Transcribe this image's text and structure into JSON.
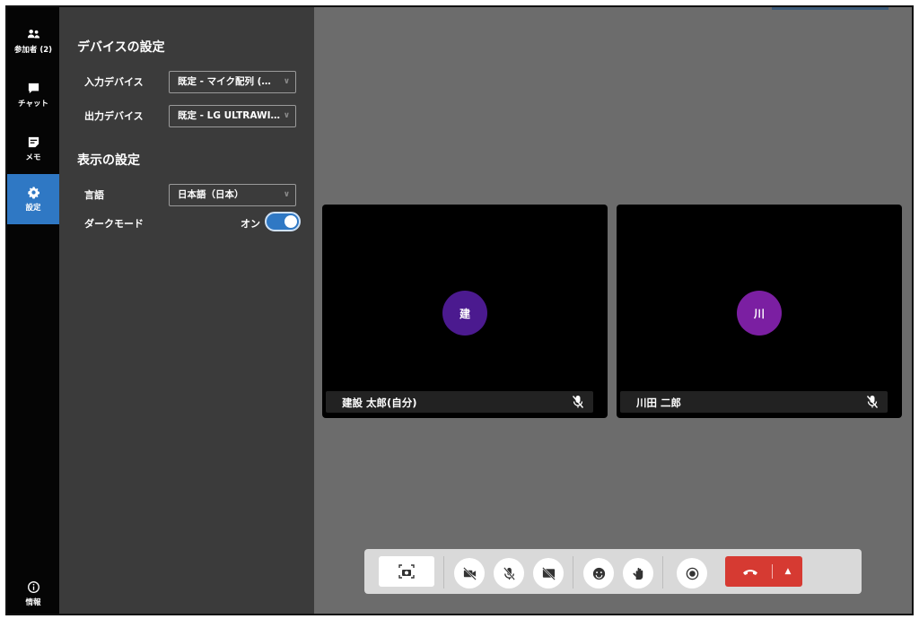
{
  "sidebar": {
    "items": [
      {
        "label": "参加者 (2)",
        "icon": "participants-icon",
        "active": false
      },
      {
        "label": "チャット",
        "icon": "chat-icon",
        "active": false
      },
      {
        "label": "メモ",
        "icon": "memo-icon",
        "active": false
      },
      {
        "label": "設定",
        "icon": "gear-icon",
        "active": true
      }
    ],
    "info": {
      "label": "情報",
      "icon": "info-icon"
    }
  },
  "settings": {
    "device_title": "デバイスの設定",
    "input_label": "入力デバイス",
    "input_value": "既定 - マイク配列 (…",
    "output_label": "出力デバイス",
    "output_value": "既定 - LG ULTRAWI…",
    "display_title": "表示の設定",
    "language_label": "言語",
    "language_value": "日本語（日本）",
    "dark_label": "ダークモード",
    "dark_state": "オン",
    "dark_on": true
  },
  "participants": [
    {
      "initial": "建",
      "name": "建設 太郎(自分)",
      "color": "#4b1a8f",
      "muted": true
    },
    {
      "initial": "川",
      "name": "川田 二郎",
      "color": "#7b1fa2",
      "muted": true
    }
  ],
  "controls": {
    "buttons": [
      "screen-share",
      "camera-off",
      "mic-off",
      "share-off",
      "reaction",
      "raise-hand",
      "record",
      "hang-up"
    ],
    "accent": "#d63a32"
  },
  "colors": {
    "active": "#2f78c4",
    "panel": "#3b3b3b",
    "stage": "#6c6c6c"
  }
}
